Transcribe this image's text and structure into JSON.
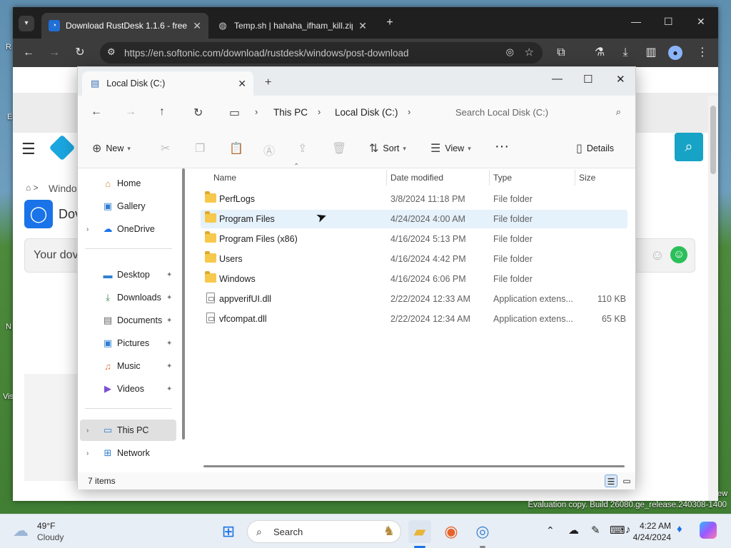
{
  "desktop": {
    "labels": [
      "R",
      "E",
      "N",
      "Vis",
      "ew"
    ]
  },
  "browser": {
    "tabs": [
      {
        "title": "Download RustDesk 1.1.6 - free",
        "active": true
      },
      {
        "title": "Temp.sh | hahaha_ifham_kill.zip",
        "active": false
      }
    ],
    "url": "https://en.softonic.com/download/rustdesk/windows/post-download",
    "page": {
      "breadcrumb_tail": "Windo",
      "app_name_prefix": "Dov",
      "notice_prefix": "Your dov"
    }
  },
  "explorer": {
    "tab_title": "Local Disk (C:)",
    "breadcrumb": [
      "This PC",
      "Local Disk (C:)"
    ],
    "search_placeholder": "Search Local Disk (C:)",
    "commands": {
      "new": "New",
      "sort": "Sort",
      "view": "View",
      "details": "Details"
    },
    "nav_pane": {
      "top": [
        "Home",
        "Gallery",
        "OneDrive"
      ],
      "quick": [
        "Desktop",
        "Downloads",
        "Documents",
        "Pictures",
        "Music",
        "Videos"
      ],
      "bottom": [
        "This PC",
        "Network"
      ]
    },
    "columns": [
      "Name",
      "Date modified",
      "Type",
      "Size"
    ],
    "files": [
      {
        "name": "PerfLogs",
        "date": "3/8/2024 11:18 PM",
        "type": "File folder",
        "size": "",
        "kind": "folder"
      },
      {
        "name": "Program Files",
        "date": "4/24/2024 4:00 AM",
        "type": "File folder",
        "size": "",
        "kind": "folder"
      },
      {
        "name": "Program Files (x86)",
        "date": "4/16/2024 5:13 PM",
        "type": "File folder",
        "size": "",
        "kind": "folder"
      },
      {
        "name": "Users",
        "date": "4/16/2024 4:42 PM",
        "type": "File folder",
        "size": "",
        "kind": "folder"
      },
      {
        "name": "Windows",
        "date": "4/16/2024 6:06 PM",
        "type": "File folder",
        "size": "",
        "kind": "folder"
      },
      {
        "name": "appverifUI.dll",
        "date": "2/22/2024 12:33 AM",
        "type": "Application extens...",
        "size": "110 KB",
        "kind": "file"
      },
      {
        "name": "vfcompat.dll",
        "date": "2/22/2024 12:34 AM",
        "type": "Application extens...",
        "size": "65 KB",
        "kind": "file"
      }
    ],
    "status": "7 items"
  },
  "watermark": "Evaluation copy. Build 26080.ge_release.240308-1400",
  "taskbar": {
    "weather_temp": "49°F",
    "weather_desc": "Cloudy",
    "search_placeholder": "Search",
    "time": "4:22 AM",
    "date": "4/24/2024"
  }
}
